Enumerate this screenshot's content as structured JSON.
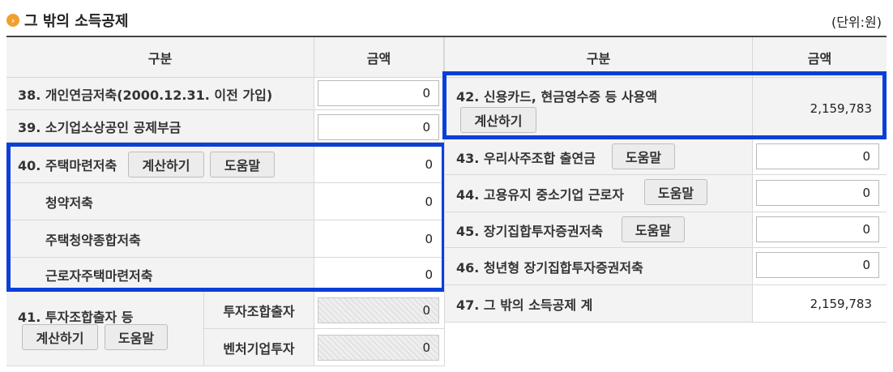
{
  "section": {
    "title": "그 밖의 소득공제",
    "unit": "(단위:원)"
  },
  "left": {
    "col_header_category": "구분",
    "col_header_amount": "금액",
    "row38": {
      "label": "38. 개인연금저축(2000.12.31. 이전 가입)",
      "value": "0"
    },
    "row39": {
      "label": "39. 소기업소상공인 공제부금",
      "value": "0"
    },
    "row40": {
      "label": "40. 주택마련저축",
      "calc_button": "계산하기",
      "help_button": "도움말",
      "value": "0"
    },
    "row40a": {
      "label": "청약저축",
      "value": "0"
    },
    "row40b": {
      "label": "주택청약종합저축",
      "value": "0"
    },
    "row40c": {
      "label": "근로자주택마련저축",
      "value": "0"
    },
    "row41": {
      "label": "41. 투자조합출자 등",
      "calc_button": "계산하기",
      "help_button": "도움말",
      "sub1_label": "투자조합출자",
      "sub1_value": "0",
      "sub2_label": "벤처기업투자",
      "sub2_value": "0"
    }
  },
  "right": {
    "col_header_category": "구분",
    "col_header_amount": "금액",
    "row42": {
      "label": "42. 신용카드, 현금영수증 등 사용액",
      "calc_button": "계산하기",
      "value": "2,159,783"
    },
    "row43": {
      "label": "43. 우리사주조합 출연금",
      "help_button": "도움말",
      "value": "0"
    },
    "row44": {
      "label": "44. 고용유지 중소기업 근로자",
      "help_button": "도움말",
      "value": "0"
    },
    "row45": {
      "label": "45. 장기집합투자증권저축",
      "help_button": "도움말",
      "value": "0"
    },
    "row46": {
      "label": "46. 청년형 장기집합투자증권저축",
      "value": "0"
    },
    "row47": {
      "label": "47. 그 밖의 소득공제 계",
      "value": "2,159,783"
    }
  },
  "colors": {
    "highlight": "#0a3fd8",
    "bullet": "#f0a030"
  }
}
